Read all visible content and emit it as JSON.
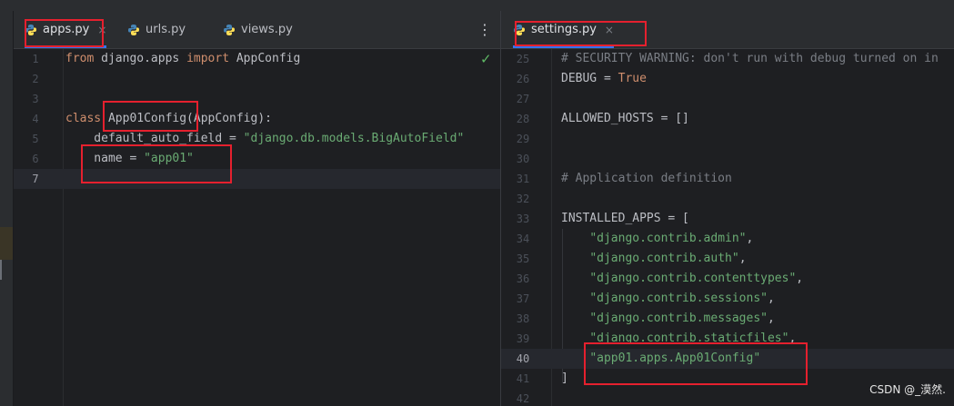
{
  "left_pane": {
    "tabs": [
      {
        "label": "apps.py",
        "close": "×"
      },
      {
        "label": "urls.py"
      },
      {
        "label": "views.py"
      }
    ],
    "menu_icon": "⋮",
    "status_icon": "checkmark-icon",
    "lines": [
      {
        "n": "1",
        "segments": [
          {
            "t": "from ",
            "c": "kw"
          },
          {
            "t": "django.apps ",
            "c": "cls"
          },
          {
            "t": "import ",
            "c": "kw"
          },
          {
            "t": "AppConfig",
            "c": "cls"
          }
        ]
      },
      {
        "n": "2",
        "segments": []
      },
      {
        "n": "3",
        "segments": []
      },
      {
        "n": "4",
        "segments": [
          {
            "t": "class ",
            "c": "kw"
          },
          {
            "t": "App01Config(AppConfig):",
            "c": "cls"
          }
        ]
      },
      {
        "n": "5",
        "segments": [
          {
            "t": "    default_auto_field = ",
            "c": "cls"
          },
          {
            "t": "\"django.db.models.BigAutoField\"",
            "c": "str"
          }
        ]
      },
      {
        "n": "6",
        "segments": [
          {
            "t": "    name = ",
            "c": "cls"
          },
          {
            "t": "\"app01\"",
            "c": "str"
          }
        ]
      },
      {
        "n": "7",
        "segments": [],
        "current": true
      }
    ]
  },
  "right_pane": {
    "tabs": [
      {
        "label": "settings.py",
        "close": "×"
      }
    ],
    "lines": [
      {
        "n": "25",
        "segments": [
          {
            "t": "# SECURITY WARNING: don't run with debug turned on in",
            "c": "cmt"
          }
        ]
      },
      {
        "n": "26",
        "segments": [
          {
            "t": "DEBUG = ",
            "c": "cls"
          },
          {
            "t": "True",
            "c": "kw"
          }
        ]
      },
      {
        "n": "27",
        "segments": []
      },
      {
        "n": "28",
        "segments": [
          {
            "t": "ALLOWED_HOSTS = []",
            "c": "cls"
          }
        ]
      },
      {
        "n": "29",
        "segments": []
      },
      {
        "n": "30",
        "segments": []
      },
      {
        "n": "31",
        "segments": [
          {
            "t": "# Application definition",
            "c": "cmt"
          }
        ]
      },
      {
        "n": "32",
        "segments": []
      },
      {
        "n": "33",
        "segments": [
          {
            "t": "INSTALLED_APPS = [",
            "c": "cls"
          }
        ]
      },
      {
        "n": "34",
        "segments": [
          {
            "t": "    ",
            "c": "cls"
          },
          {
            "t": "\"django.contrib.admin\"",
            "c": "str"
          },
          {
            "t": ",",
            "c": "cls"
          }
        ]
      },
      {
        "n": "35",
        "segments": [
          {
            "t": "    ",
            "c": "cls"
          },
          {
            "t": "\"django.contrib.auth\"",
            "c": "str"
          },
          {
            "t": ",",
            "c": "cls"
          }
        ]
      },
      {
        "n": "36",
        "segments": [
          {
            "t": "    ",
            "c": "cls"
          },
          {
            "t": "\"django.contrib.contenttypes\"",
            "c": "str"
          },
          {
            "t": ",",
            "c": "cls"
          }
        ]
      },
      {
        "n": "37",
        "segments": [
          {
            "t": "    ",
            "c": "cls"
          },
          {
            "t": "\"django.contrib.sessions\"",
            "c": "str"
          },
          {
            "t": ",",
            "c": "cls"
          }
        ]
      },
      {
        "n": "38",
        "segments": [
          {
            "t": "    ",
            "c": "cls"
          },
          {
            "t": "\"django.contrib.messages\"",
            "c": "str"
          },
          {
            "t": ",",
            "c": "cls"
          }
        ]
      },
      {
        "n": "39",
        "segments": [
          {
            "t": "    ",
            "c": "cls"
          },
          {
            "t": "\"django.contrib.staticfiles\"",
            "c": "str"
          },
          {
            "t": ",",
            "c": "cls"
          }
        ]
      },
      {
        "n": "40",
        "segments": [
          {
            "t": "    ",
            "c": "cls"
          },
          {
            "t": "\"app01.apps.App01Config\"",
            "c": "str"
          }
        ],
        "current": true
      },
      {
        "n": "41",
        "segments": [
          {
            "t": "]",
            "c": "cls"
          }
        ]
      },
      {
        "n": "42",
        "segments": []
      }
    ]
  },
  "watermark": "CSDN @_漠然.",
  "colors": {
    "keyword": "#cf8e6d",
    "string": "#6aab73",
    "comment": "#7a7e85",
    "highlight": "#e5202e",
    "accent": "#3574f0"
  }
}
